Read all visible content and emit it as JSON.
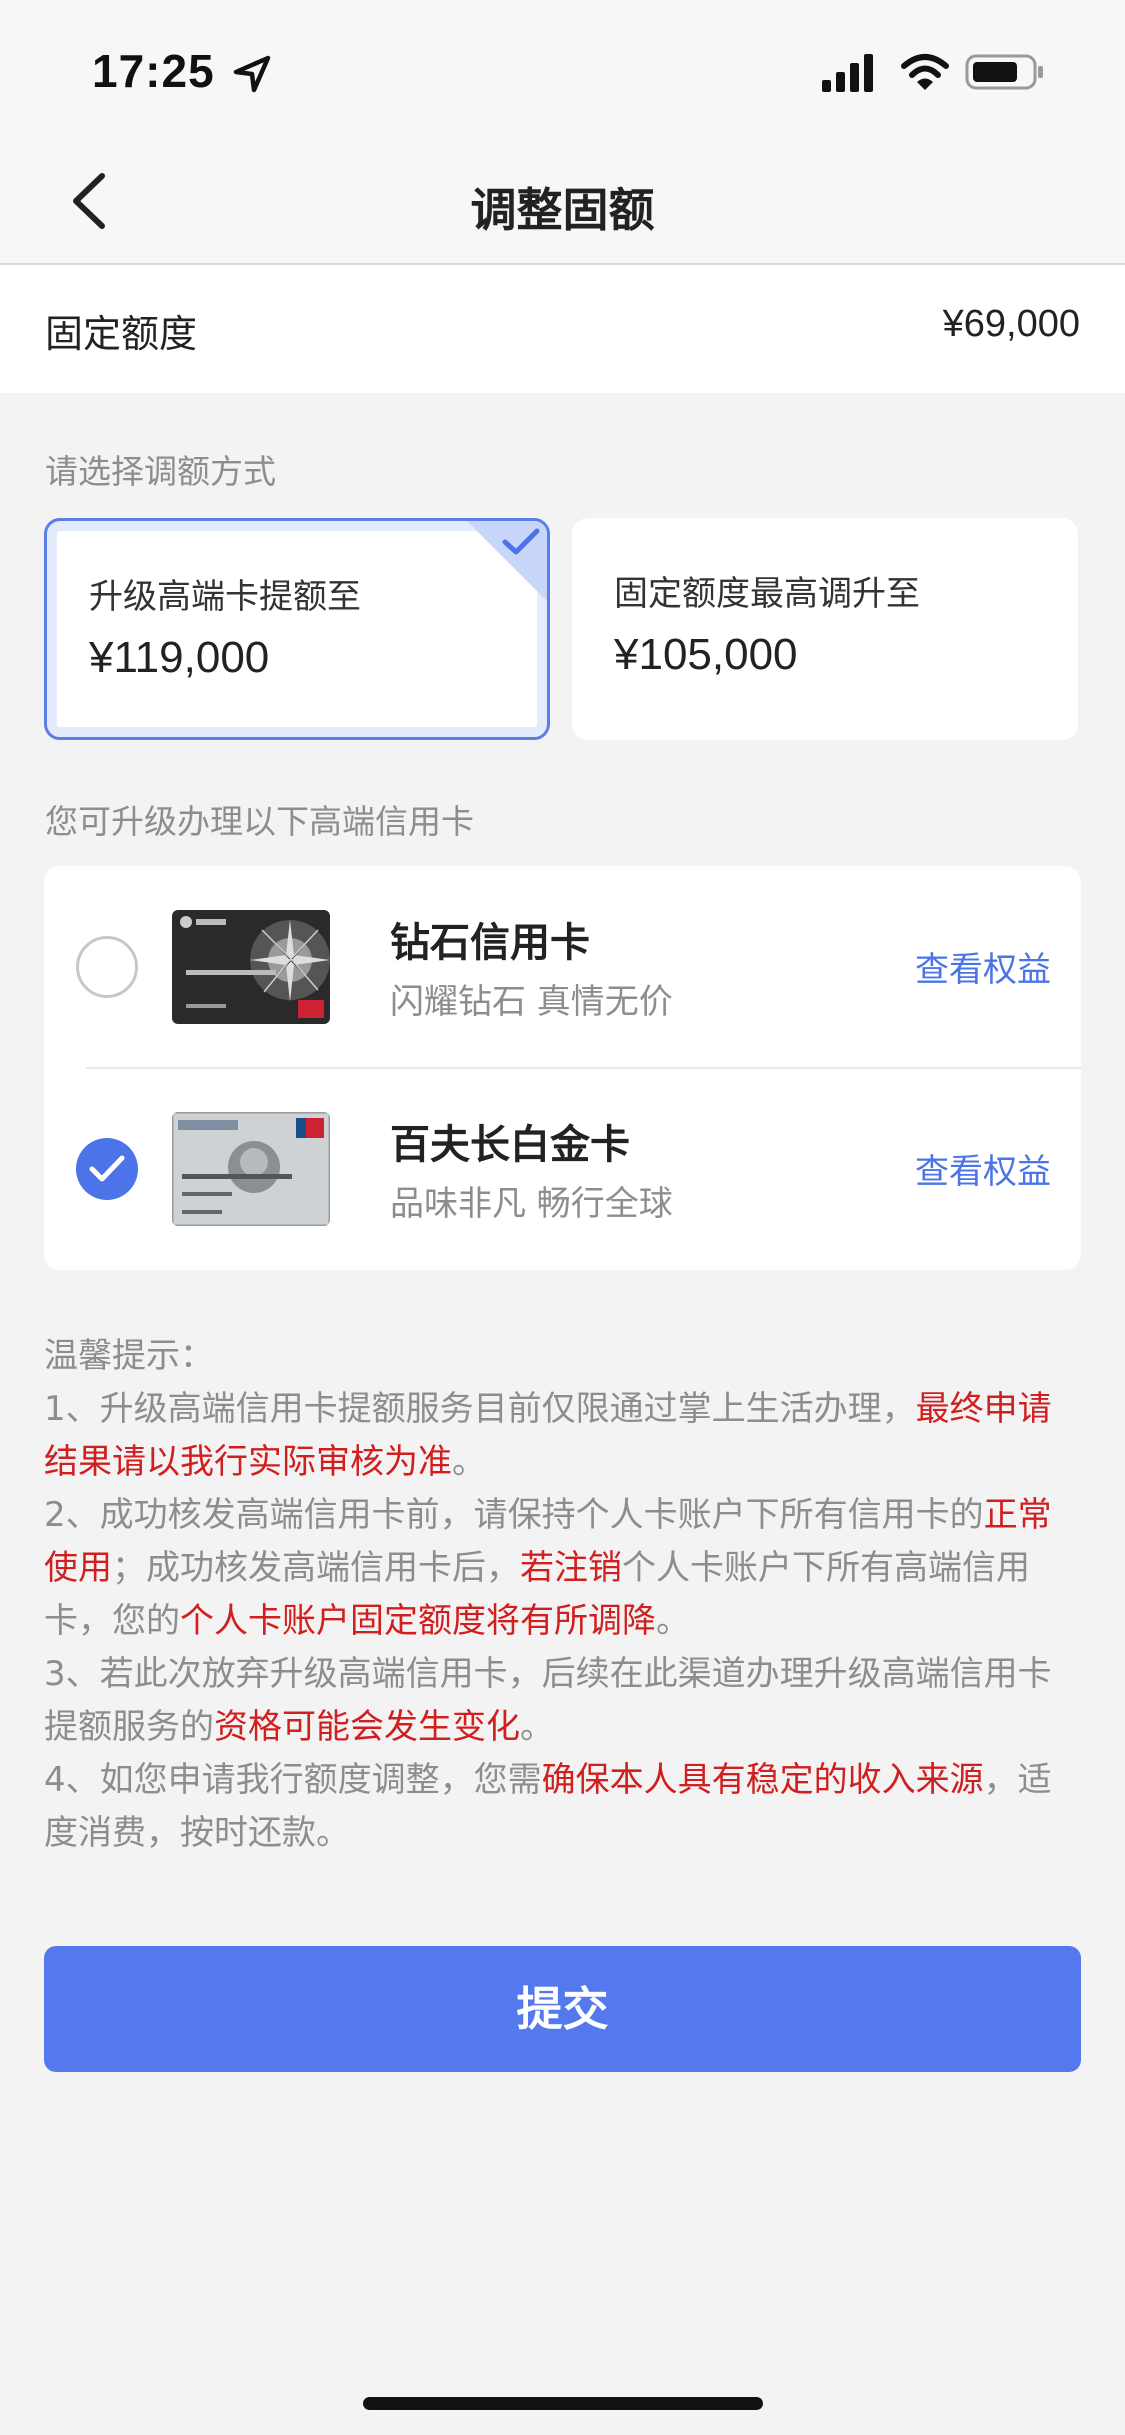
{
  "status_bar": {
    "time": "17:25"
  },
  "header": {
    "title": "调整固额"
  },
  "fixed_limit": {
    "label": "固定额度",
    "value": "¥69,000"
  },
  "adjust_method": {
    "section_label": "请选择调额方式",
    "options": [
      {
        "label": "升级高端卡提额至",
        "amount": "¥119,000",
        "selected": true
      },
      {
        "label": "固定额度最高调升至",
        "amount": "¥105,000",
        "selected": false
      }
    ]
  },
  "cards": {
    "section_label": "您可升级办理以下高端信用卡",
    "items": [
      {
        "name": "钻石信用卡",
        "desc": "闪耀钻石 真情无价",
        "link": "查看权益",
        "selected": false
      },
      {
        "name": "百夫长白金卡",
        "desc": "品味非凡 畅行全球",
        "link": "查看权益",
        "selected": true
      }
    ]
  },
  "tips": {
    "title": "温馨提示：",
    "t1a": "1、升级高端信用卡提额服务目前仅限通过掌上生活办理，",
    "t1b": "最终申请结果请以我行实际审核为准",
    "t1c": "。",
    "t2a": "2、成功核发高端信用卡前，请保持个人卡账户下所有信用卡的",
    "t2b": "正常使用",
    "t2c": "；成功核发高端信用卡后，",
    "t2d": "若注销",
    "t2e": "个人卡账户下所有高端信用卡，您的",
    "t2f": "个人卡账户固定额度将有所调降",
    "t2g": "。",
    "t3a": "3、若此次放弃升级高端信用卡，后续在此渠道办理升级高端信用卡提额服务的",
    "t3b": "资格可能会发生变化",
    "t3c": "。",
    "t4a": "4、如您申请我行额度调整，您需",
    "t4b": "确保本人具有稳定的收入来源",
    "t4c": "，适度消费，按时还款。"
  },
  "submit_label": "提交",
  "colors": {
    "accent": "#5479ee",
    "highlight": "#d11f1f",
    "muted": "#8d8d8d"
  }
}
